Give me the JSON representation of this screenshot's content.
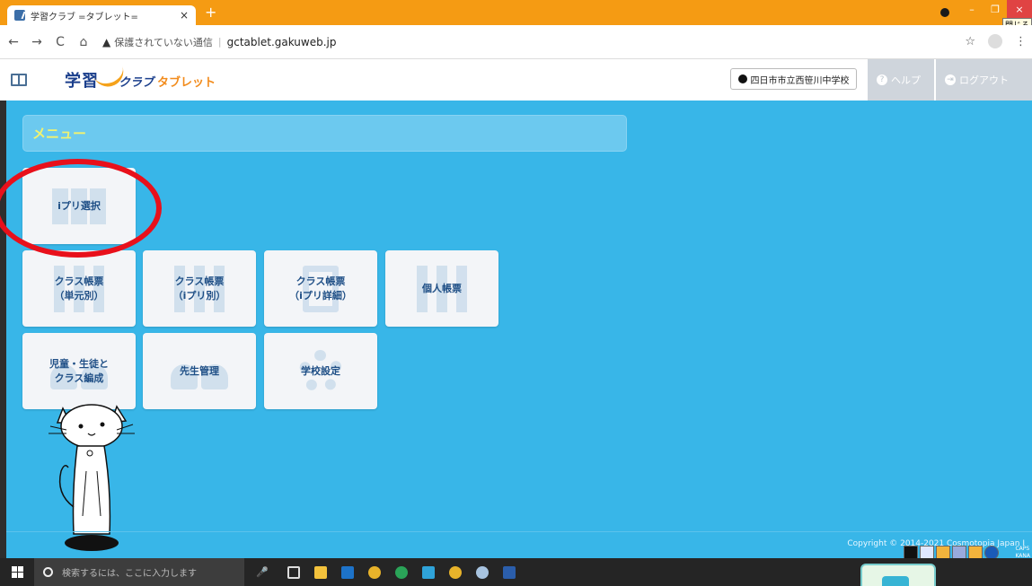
{
  "browser": {
    "tab_title": "学習クラブ =タブレット=",
    "tab_close": "×",
    "new_tab": "+",
    "close_tooltip": "閉じる",
    "minimize": "–",
    "maximize": "❐",
    "close": "×",
    "back": "←",
    "forward": "→",
    "reload": "C",
    "home": "⌂",
    "warning_icon": "▲",
    "security_text": "保護されていない通信",
    "separator": "|",
    "url": "gctablet.gakuweb.jp",
    "bookmark_star": "☆",
    "menu": "⋮",
    "profile": "👤"
  },
  "header": {
    "logo_main": "学習",
    "logo_sub": "クラブ",
    "logo_tablet": "タブレット",
    "school_name": "四日市市立西笹川中学校",
    "help_label": "ヘルプ",
    "help_icon": "?",
    "logout_label": "ログアウト",
    "logout_icon": "⇥"
  },
  "main": {
    "menu_title": "メニュー",
    "tiles": [
      {
        "label": "iプリ選択",
        "icon": "map-icon"
      },
      {
        "label": "クラス帳票\n（単元別）",
        "icon": "bars-icon"
      },
      {
        "label": "クラス帳票\n（iプリ別）",
        "icon": "bars-icon"
      },
      {
        "label": "クラス帳票\n（iプリ詳細）",
        "icon": "document-icon"
      },
      {
        "label": "個人帳票",
        "icon": "bars-icon"
      },
      {
        "label": "児童・生徒と\nクラス編成",
        "icon": "people-icon"
      },
      {
        "label": "先生管理",
        "icon": "people-icon"
      },
      {
        "label": "学校設定",
        "icon": "gear-icon"
      }
    ],
    "copyright": "Copyright © 2014-2021 Cosmotopia Japan I"
  },
  "taskbar": {
    "search_placeholder": "検索するには、ここに入力します",
    "mic": "🎤",
    "tray_text_1": "CAPS",
    "tray_text_2": "KANA"
  },
  "colors": {
    "main_bg": "#38b6e8",
    "menu_title": "#f1f26f",
    "tile_text": "#1f4f86",
    "annotation": "#e8101b",
    "titlebar": "#f59b13"
  }
}
